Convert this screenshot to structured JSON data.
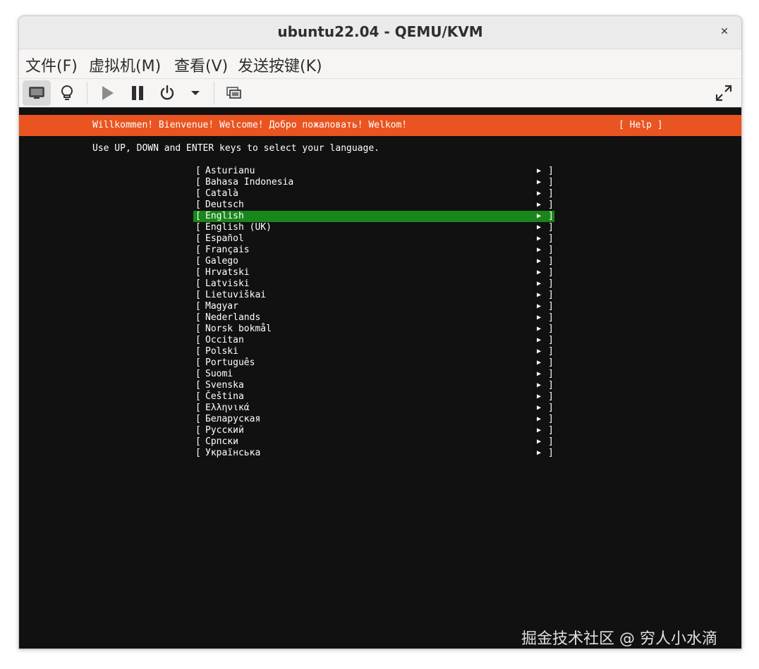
{
  "window": {
    "title": "ubuntu22.04 - QEMU/KVM",
    "close_glyph": "✕"
  },
  "menubar": {
    "items": [
      "文件(F)",
      "虚拟机(M)",
      "查看(V)",
      "发送按键(K)"
    ]
  },
  "toolbar": {
    "icons": [
      "console-icon",
      "lightbulb-icon",
      "play-icon",
      "pause-icon",
      "power-icon",
      "dropdown-arrow-icon",
      "screenshot-icon",
      "fullscreen-icon"
    ]
  },
  "installer": {
    "welcome": "Willkommen! Bienvenue! Welcome! Добро пожаловать! Welkom!",
    "help": "[ Help ]",
    "instruction": "Use UP, DOWN and ENTER keys to select your language.",
    "selected_index": 4,
    "languages": [
      "Asturianu",
      "Bahasa Indonesia",
      "Català",
      "Deutsch",
      "English",
      "English (UK)",
      "Español",
      "Français",
      "Galego",
      "Hrvatski",
      "Latviski",
      "Lietuviškai",
      "Magyar",
      "Nederlands",
      "Norsk bokmål",
      "Occitan",
      "Polski",
      "Português",
      "Suomi",
      "Svenska",
      "Čeština",
      "Ελληνικά",
      "Беларуская",
      "Русский",
      "Српски",
      "Українська"
    ]
  },
  "colors": {
    "header_bar": "#e95420",
    "selected_row": "#19861c",
    "screen_bg": "#111111"
  },
  "watermark": "掘金技术社区 @ 穷人小水滴"
}
